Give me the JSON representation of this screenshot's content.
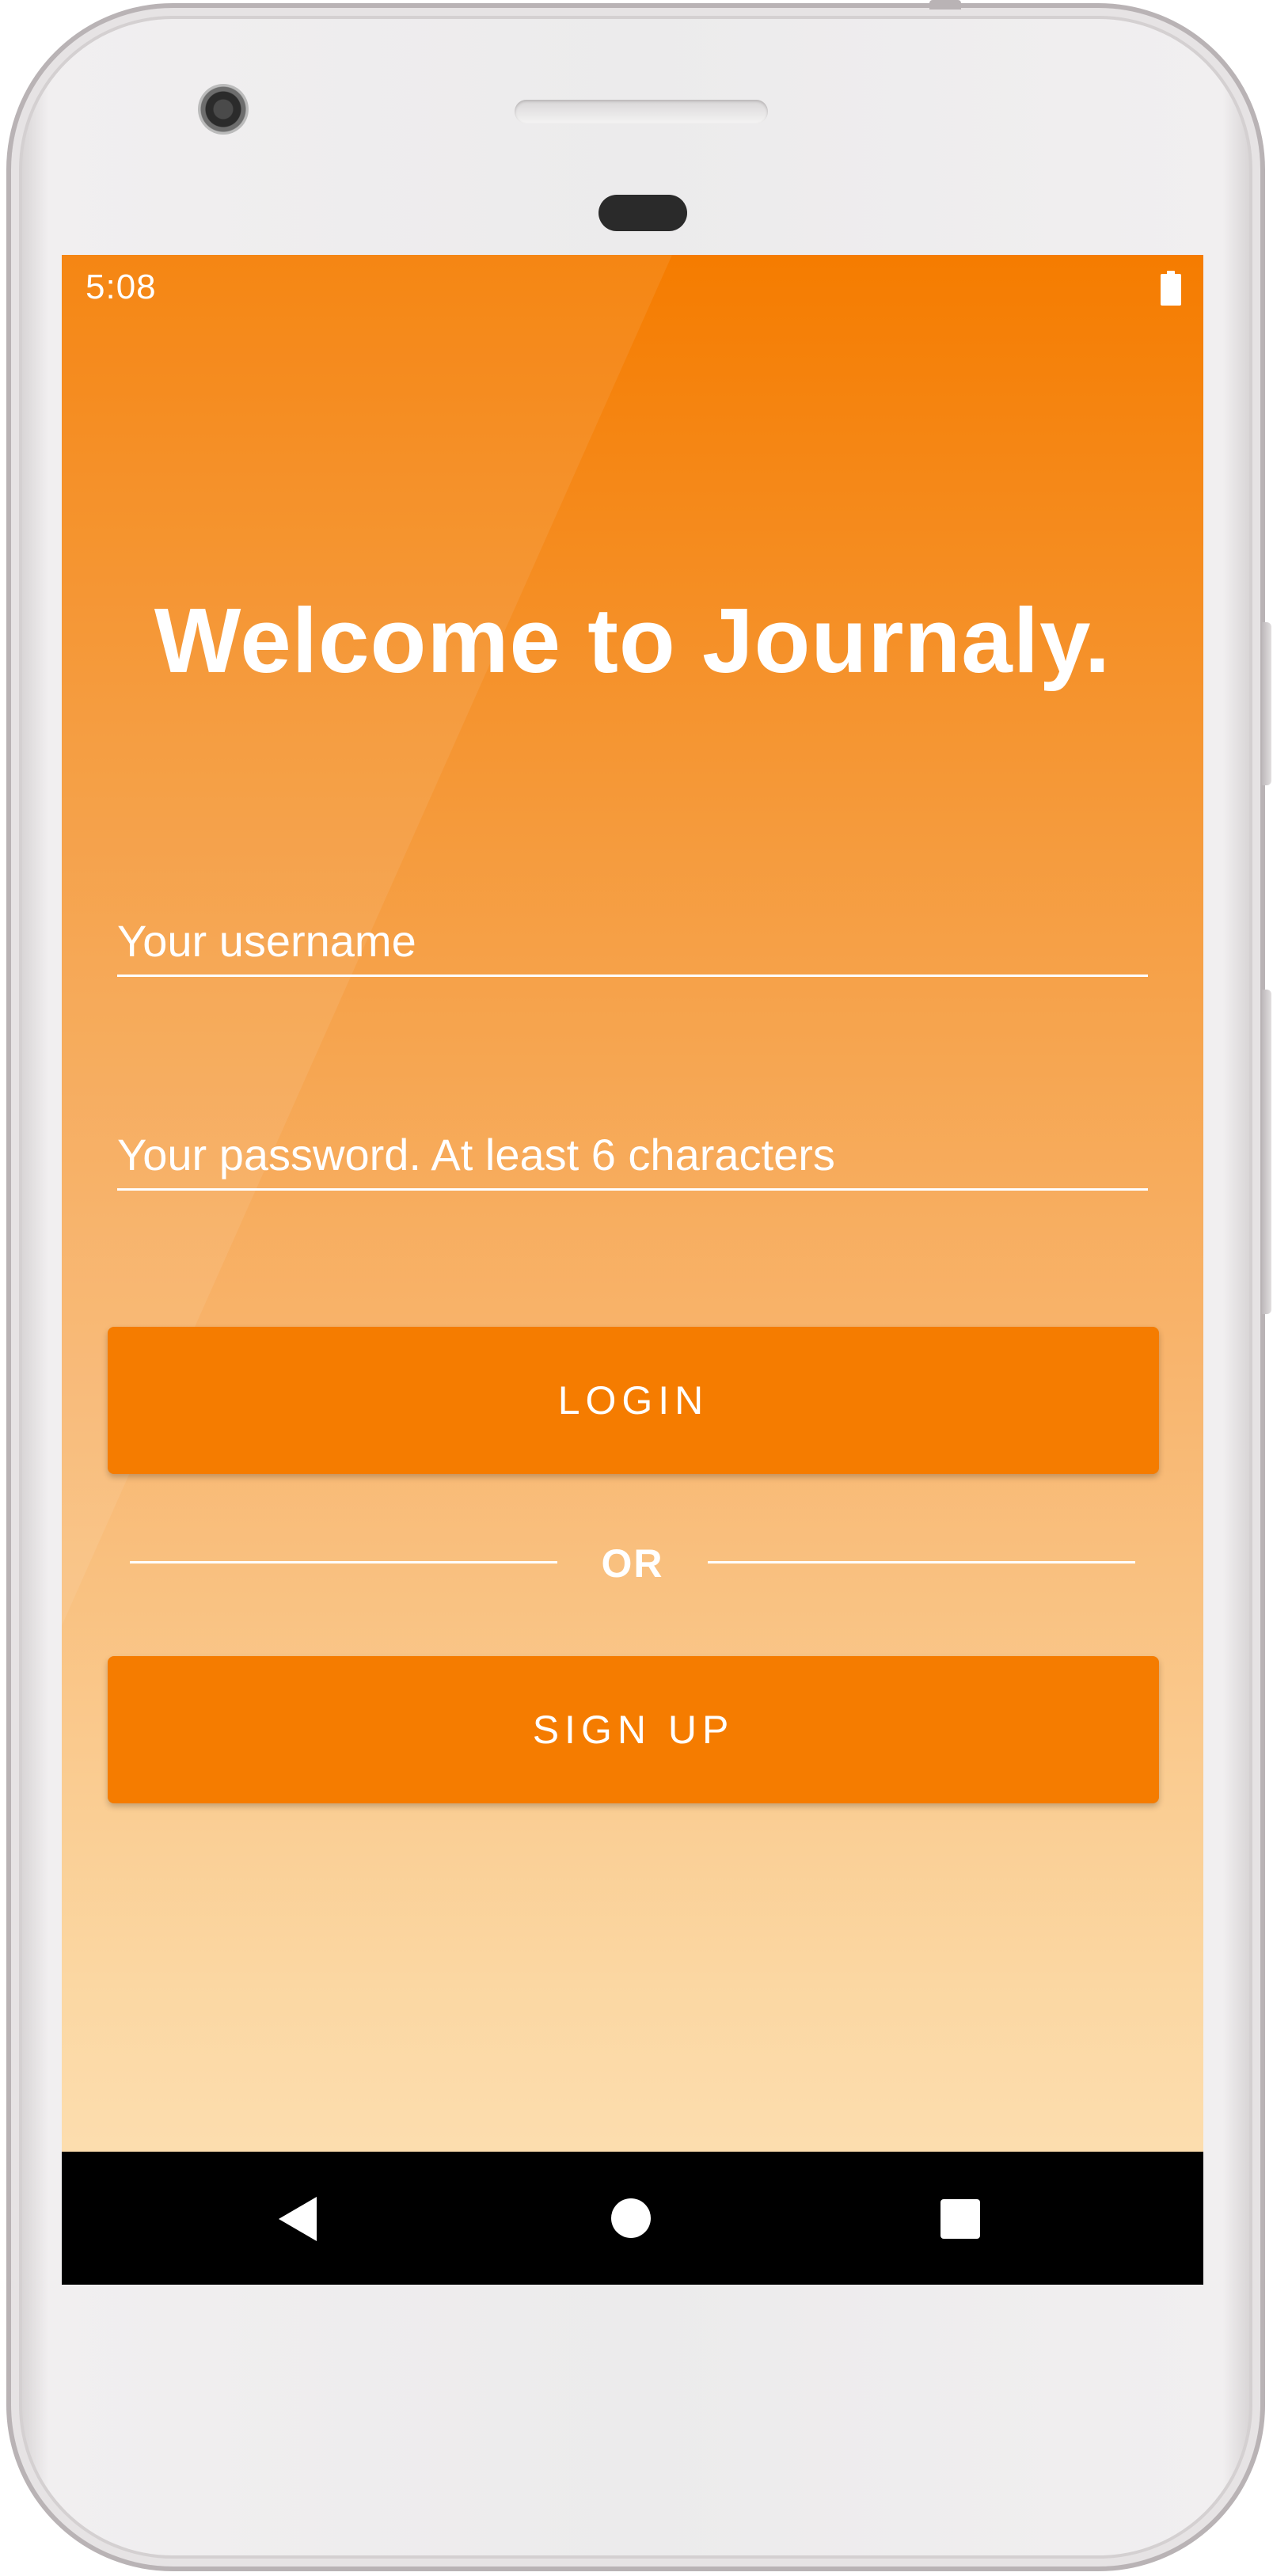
{
  "status_bar": {
    "time": "5:08",
    "battery_icon": "battery-full-icon"
  },
  "login_screen": {
    "title": "Welcome to Journaly.",
    "username_field": {
      "placeholder": "Your username",
      "value": ""
    },
    "password_field": {
      "placeholder": "Your password. At least 6 characters",
      "value": ""
    },
    "login_button_label": "LOGIN",
    "divider_label": "OR",
    "signup_button_label": "SIGN UP"
  },
  "nav_bar": {
    "back_icon": "back-triangle-icon",
    "home_icon": "home-circle-icon",
    "recents_icon": "recents-square-icon"
  },
  "colors": {
    "accent": "#f57c00",
    "gradient_top": "#f57c00",
    "gradient_bottom": "#fde2b8",
    "text": "#ffffff",
    "nav_bar": "#000000"
  }
}
